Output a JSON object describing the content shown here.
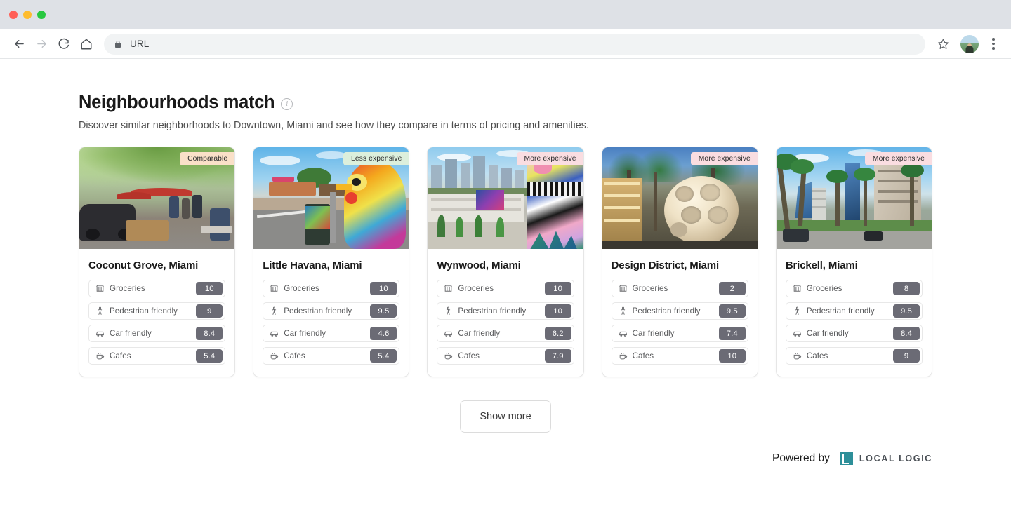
{
  "browser": {
    "back_icon": "back-arrow-icon",
    "forward_icon": "forward-arrow-icon",
    "reload_icon": "reload-icon",
    "home_icon": "home-icon",
    "lock_icon": "lock-icon",
    "url": "URL",
    "star_icon": "bookmark-star-icon",
    "avatar_icon": "profile-avatar",
    "menu_icon": "three-dot-menu-icon"
  },
  "header": {
    "title": "Neighbourhoods match",
    "info_icon": "info-icon",
    "subtitle": "Discover similar neighborhoods to Downtown, Miami and see how they compare in terms of pricing and amenities."
  },
  "badge_colors": {
    "comparable": "#fae0c8",
    "less_expensive": "#dcefdc",
    "more_expensive": "#fadde1"
  },
  "score_color": "#6b6b75",
  "metric_icons": [
    "groceries-storefront-icon",
    "pedestrian-icon",
    "car-icon",
    "cafe-cup-icon"
  ],
  "cards": [
    {
      "name": "Coconut Grove, Miami",
      "badge": "Comparable",
      "badge_type": "comparable",
      "photo": "leafy-street-cafe-photo",
      "metrics": [
        {
          "label": "Groceries",
          "score": "10"
        },
        {
          "label": "Pedestrian friendly",
          "score": "9"
        },
        {
          "label": "Car friendly",
          "score": "8.4"
        },
        {
          "label": "Cafes",
          "score": "5.4"
        }
      ]
    },
    {
      "name": "Little Havana, Miami",
      "badge": "Less expensive",
      "badge_type": "less_expensive",
      "photo": "colorful-rooster-sculpture-photo",
      "metrics": [
        {
          "label": "Groceries",
          "score": "10"
        },
        {
          "label": "Pedestrian friendly",
          "score": "9.5"
        },
        {
          "label": "Car friendly",
          "score": "4.6"
        },
        {
          "label": "Cafes",
          "score": "5.4"
        }
      ]
    },
    {
      "name": "Wynwood, Miami",
      "badge": "More expensive",
      "badge_type": "more_expensive",
      "photo": "wynwood-murals-skyline-photo",
      "metrics": [
        {
          "label": "Groceries",
          "score": "10"
        },
        {
          "label": "Pedestrian friendly",
          "score": "10"
        },
        {
          "label": "Car friendly",
          "score": "6.2"
        },
        {
          "label": "Cafes",
          "score": "7.9"
        }
      ]
    },
    {
      "name": "Design District, Miami",
      "badge": "More expensive",
      "badge_type": "more_expensive",
      "photo": "flys-eye-dome-photo",
      "metrics": [
        {
          "label": "Groceries",
          "score": "2"
        },
        {
          "label": "Pedestrian friendly",
          "score": "9.5"
        },
        {
          "label": "Car friendly",
          "score": "7.4"
        },
        {
          "label": "Cafes",
          "score": "10"
        }
      ]
    },
    {
      "name": "Brickell, Miami",
      "badge": "More expensive",
      "badge_type": "more_expensive",
      "photo": "palm-lined-highrise-street-photo",
      "metrics": [
        {
          "label": "Groceries",
          "score": "8"
        },
        {
          "label": "Pedestrian friendly",
          "score": "9.5"
        },
        {
          "label": "Car friendly",
          "score": "8.4"
        },
        {
          "label": "Cafes",
          "score": "9"
        }
      ]
    }
  ],
  "show_more_label": "Show more",
  "footer": {
    "powered_by": "Powered by",
    "brand": "LOCAL LOGIC",
    "brand_mark": "local-logic-logo-icon"
  }
}
